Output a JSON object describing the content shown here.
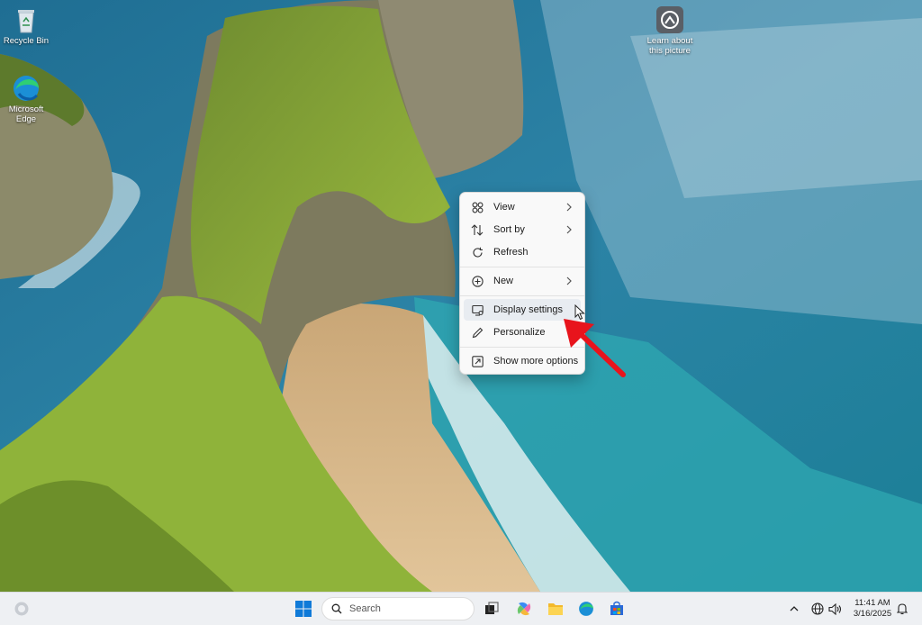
{
  "desktop": {
    "icons": [
      {
        "label": "Recycle Bin",
        "icon": "recycle-bin-icon"
      },
      {
        "label": "Microsoft Edge",
        "icon": "edge-icon"
      },
      {
        "label": "Learn about this picture",
        "icon": "learn-about-picture-icon"
      }
    ]
  },
  "context_menu": {
    "items": [
      {
        "label": "View",
        "icon": "view-grid-icon",
        "submenu": true
      },
      {
        "label": "Sort by",
        "icon": "sort-icon",
        "submenu": true
      },
      {
        "label": "Refresh",
        "icon": "refresh-icon",
        "submenu": false
      },
      {
        "label": "New",
        "icon": "new-plus-icon",
        "submenu": true
      },
      {
        "label": "Display settings",
        "icon": "display-settings-icon",
        "submenu": false,
        "hovered": true
      },
      {
        "label": "Personalize",
        "icon": "personalize-pen-icon",
        "submenu": false
      },
      {
        "label": "Show more options",
        "icon": "show-more-options-icon",
        "submenu": false
      }
    ]
  },
  "annotation": {
    "arrow_color": "#e8141c"
  },
  "taskbar": {
    "search_placeholder": "Search",
    "pinned": [
      "task-view-icon",
      "copilot-icon",
      "file-explorer-icon",
      "edge-icon",
      "microsoft-store-icon"
    ],
    "tray": {
      "time": "11:41 AM",
      "date": "3/16/2025"
    }
  },
  "colors": {
    "accent": "#0067c0",
    "menu_bg": "#f9f9f9",
    "taskbar_bg": "#eef0f3"
  }
}
